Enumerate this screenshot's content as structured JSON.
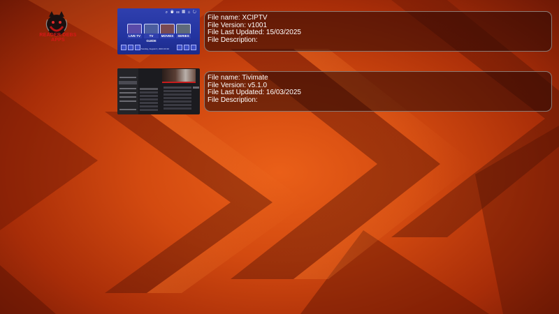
{
  "brand": {
    "logo_text": "READER DEBS APPS",
    "colors": {
      "accent": "#d81818",
      "background": "#c8400c",
      "panel_border": "#8a7a74"
    }
  },
  "files": [
    {
      "name_line": "File name: XCIPTV",
      "version_line": "File Version: v1001",
      "updated_line": "File Last Updated: 15/03/2025",
      "description_line": "File Description:",
      "thumbnail": {
        "tiles": [
          "LIVE TV",
          "TV GUIDE",
          "MOVIES",
          "SERIES"
        ],
        "date_text": "Sunday, August 4, 2024 23:10"
      }
    },
    {
      "name_line": "File name: Tivimate",
      "version_line": "File Version: v5.1.0",
      "updated_line": "File Last Updated: 16/03/2025",
      "description_line": "File Description:"
    }
  ]
}
